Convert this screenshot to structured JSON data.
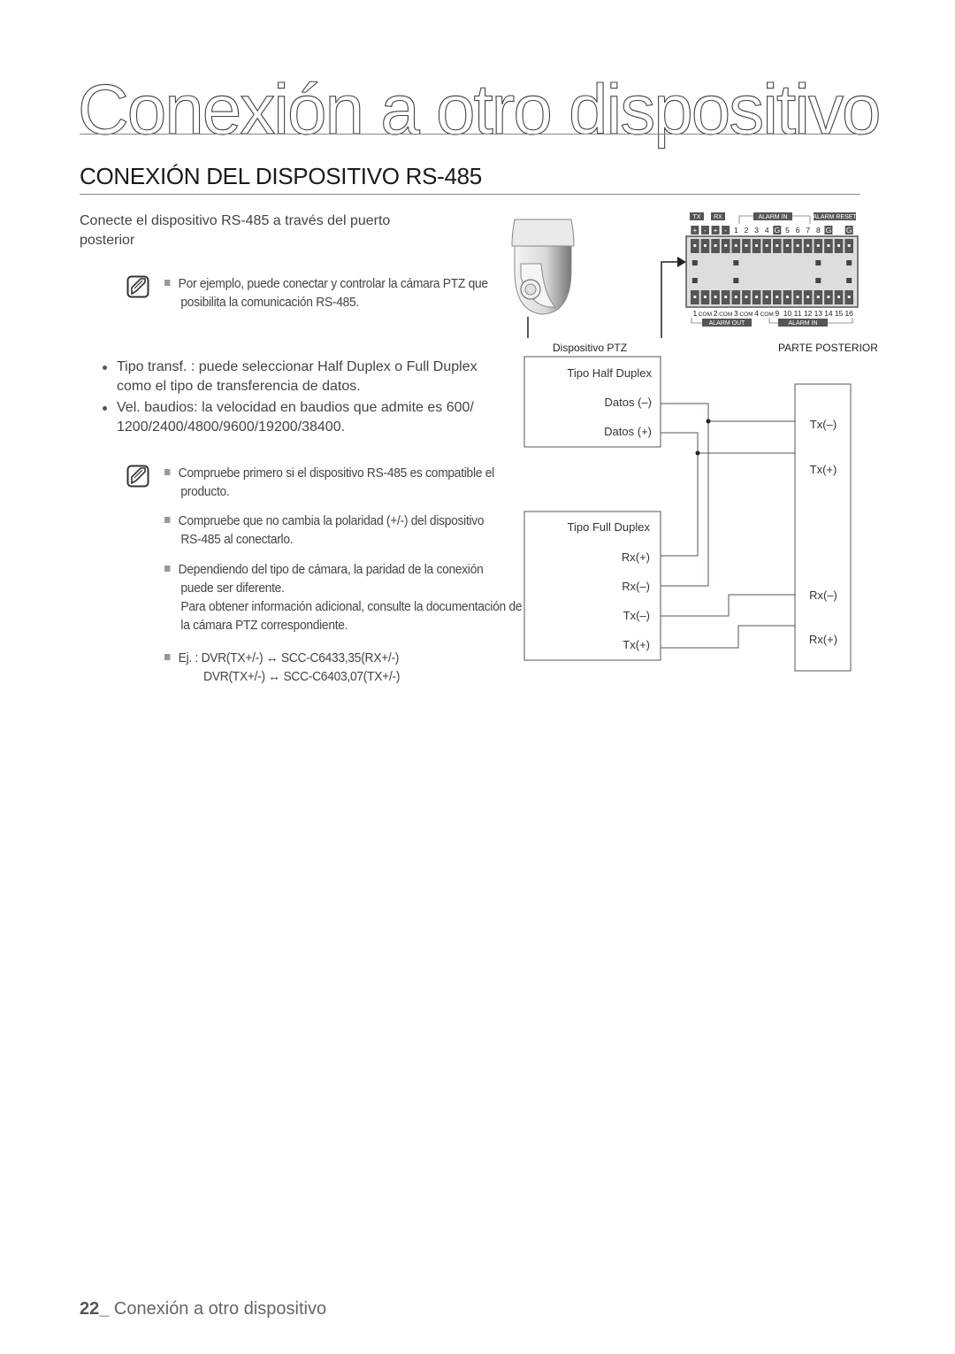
{
  "page": {
    "title": "Conexión a otro dispositivo",
    "section_title": "CONEXIÓN DEL DISPOSITIVO RS-485",
    "intro": "Conecte el dispositivo RS-485 a través del puerto posterior"
  },
  "note1": {
    "icon": "note-pencil-icon",
    "items": [
      "Por ejemplo, puede conectar y controlar la cámara PTZ que posibilita la comunicación RS-485."
    ]
  },
  "bullets": [
    "Tipo transf. : puede seleccionar Half Duplex o Full Duplex como el tipo de transferencia de datos.",
    "Vel. baudios: la velocidad en baudios que admite es 600/ 1200/2400/4800/9600/19200/38400."
  ],
  "note2": {
    "icon": "note-pencil-icon",
    "items": [
      "Compruebe primero si el dispositivo RS-485 es compatible el producto.",
      "Compruebe que no cambia la polaridad (+/-) del dispositivo RS-485 al conectarlo.",
      "Dependiendo del tipo de cámara, la paridad de la conexión puede ser diferente.",
      "Para obtener información adicional, consulte la documentación de la cámara PTZ correspondiente.",
      "Ej. : DVR(TX+/-) ↔ SCC-C6433,35(RX+/-)",
      "DVR(TX+/-) ↔ SCC-C6403,07(TX+/-)"
    ]
  },
  "diagram": {
    "ptz_label": "Dispositivo PTZ",
    "rear_label": "PARTE POSTERIOR",
    "terminal": {
      "top_group_labels": [
        "TX",
        "RX",
        "ALARM IN",
        "ALARM RESET"
      ],
      "top_pins": [
        "+",
        "-",
        "+",
        "-",
        "1",
        "2",
        "3",
        "4",
        "G",
        "5",
        "6",
        "7",
        "8",
        "G",
        "",
        "G"
      ],
      "bottom_pins": [
        "1",
        "COM",
        "2",
        "COM",
        "3",
        "COM",
        "4",
        "COM",
        "9",
        "10",
        "11",
        "12",
        "13",
        "14",
        "15",
        "16"
      ],
      "bottom_group_labels": [
        "ALARM OUT",
        "ALARM IN"
      ]
    },
    "half_duplex": {
      "title": "Tipo Half Duplex",
      "pins": [
        "Datos (–)",
        "Datos (+)"
      ]
    },
    "full_duplex": {
      "title": "Tipo Full Duplex",
      "pins": [
        "Rx(+)",
        "Rx(–)",
        "Tx(–)",
        "Tx(+)"
      ]
    },
    "dvr_pins": [
      "Tx(–)",
      "Tx(+)",
      "Rx(–)",
      "Rx(+)"
    ]
  },
  "footer": {
    "page_number": "22",
    "separator": "_",
    "text": " Conexión a otro dispositivo"
  }
}
